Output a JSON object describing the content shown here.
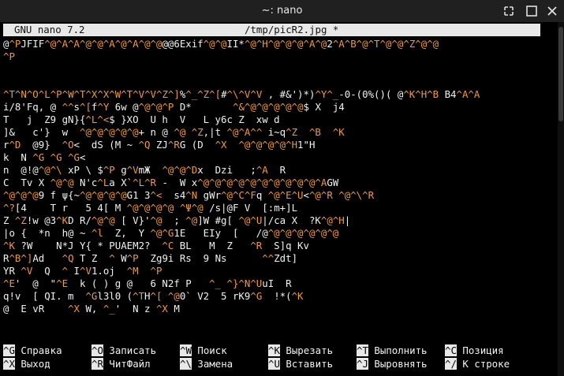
{
  "window": {
    "title": "~: nano"
  },
  "header": {
    "app": "GNU nano 7.2",
    "file": "/tmp/picR2.jpg *"
  },
  "content": {
    "lines": [
      "@^PJFIF^@^A^A^@^@^A^@^A^@^@@@6Exif^@^@II*^@^H^@^@^@^A^@2^A^B^@^T^@^@^Z^@^@",
      "^P",
      "",
      "",
      "^T^N^O^L^P^W^T^X^X^W^T^V^V^Z^]%^_^Z^[#^\\^V^V , #&')*)^Y^_-0-(0%()( @^K^H^B B4^A^A",
      "i/8'Fq, @ ^^s^[f^Y 6w @^@^@^P D*       ^&^@^@^@^@^@$ X  j4",
      "T   j  Z9 gN}{^L^<$ }XO  U h  V   L y6c Z  xw d",
      "]&   c'}  w  ^@^@^@^@^@+ n @ ^@ ^Z,|t ^@^A^^ i~q^Z  ^B  ^K",
      "r^D  @9}  ^O<  dS (M ~ ^Q ZJ^RG (D  ^X  ^@^@^@^@^H1\"H",
      "k  N ^G ^G ^G<",
      "n  @!@^@^\\ xP \\ $^P g^VmЖ  ^@^@^Dx  Dzi   ;^A  R",
      "C  Tv X ^@^@ N'c^La X`^L^R -  W x^@^@^@^@^@^@^@^@^@^@^AGW",
      "^@^@^@9 f ψ{~^@^@^@^@G1 3^<  s4^N gWr^@^C^Fq ^@^E^U<^@^R ^@^\\^R",
      "^?[4    T r   5 4[ M ^@^@^@^@ ^Ψ^@ /s|@F V  [:m+]L",
      "Z ^Z!w @3^KD R/^@^@ [ V}'^@  ; ^@]W #g[ ^@^U|/ca X  ?K^@^H| ",
      "|o {  *n  h@ ~ ^l  Z,  Y ^@^G1E   EIy  [   /@^@^@^@^@^@^@",
      "^K ?W    N*J Y{ * PUAEM2?  ^C BL   M  Z   ^R  S]q Kv",
      "R^B^]Ad   ^Q T Z  ^ W^P  Zg9i Rs  9 Ns      ^^Zdt]",
      "YR ^V  Q  ^ I^V1.oj  ^M  ^P",
      "^E'  @  \"^E  k ( ) g @   6 N2f P   ^_ ^}^N^UuI  R",
      "q!v  [ QI. m  ^Gl3l0 (^TH^[ ^@0` V2  5 rK9^G  !*(^K ",
      "@  E vR    ^X W, ^_'  N z ^X M"
    ]
  },
  "shortcuts": [
    {
      "key": "^G",
      "label": "Справка"
    },
    {
      "key": "^O",
      "label": "Записать"
    },
    {
      "key": "^W",
      "label": "Поиск"
    },
    {
      "key": "^K",
      "label": "Вырезать"
    },
    {
      "key": "^T",
      "label": "Выполнить"
    },
    {
      "key": "^C",
      "label": "Позиция"
    },
    {
      "key": "^X",
      "label": "Выход"
    },
    {
      "key": "^R",
      "label": "ЧитФайл"
    },
    {
      "key": "^\\",
      "label": "Замена"
    },
    {
      "key": "^U",
      "label": "Вставить"
    },
    {
      "key": "^J",
      "label": "Выровнять"
    },
    {
      "key": "^/",
      "label": "К строке"
    }
  ],
  "colors": {
    "control_char": "#f09a3a",
    "header_bg": "#e8e8e8",
    "terminal_bg": "#000000"
  },
  "icons": {
    "maximize": "maximize-icon",
    "close": "close-icon"
  }
}
